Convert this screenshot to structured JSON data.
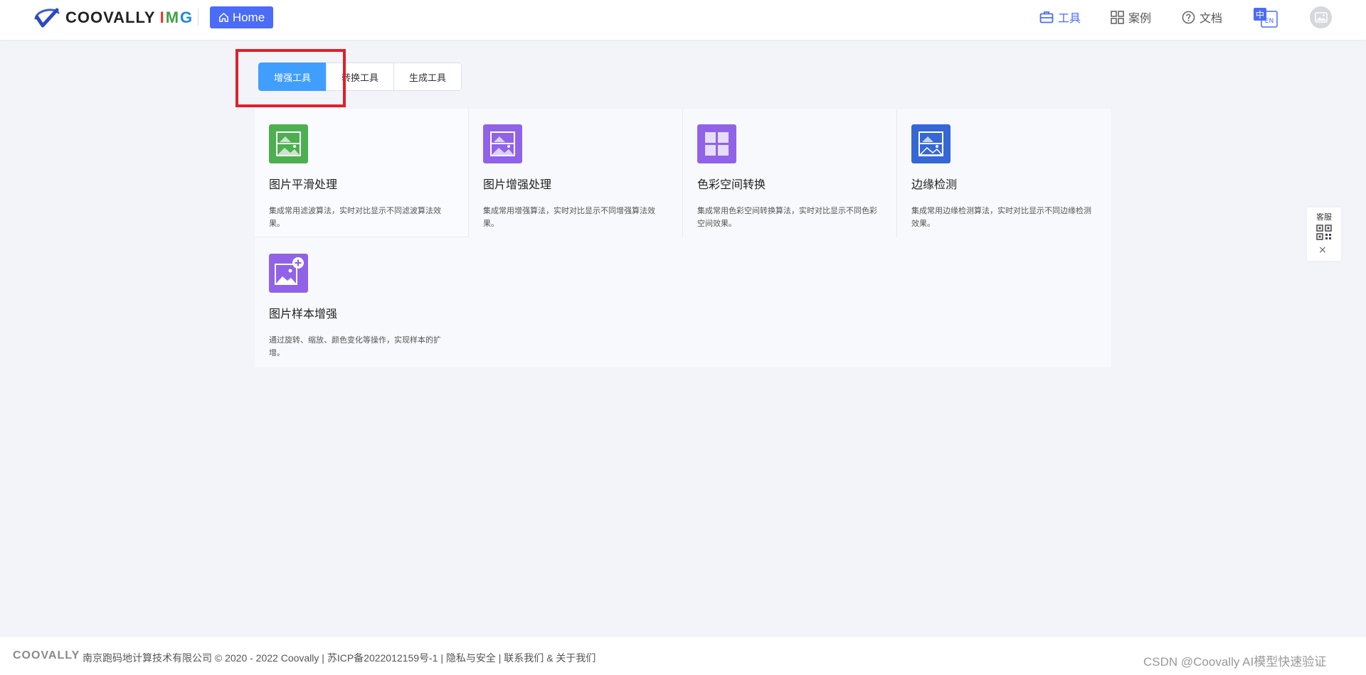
{
  "header": {
    "logo": {
      "word": "COOVALLY",
      "suffix": "IMG"
    },
    "home_button": {
      "label": "Home",
      "icon": "home-icon"
    },
    "nav": [
      {
        "label": "工具",
        "icon": "toolbox-icon",
        "active": true
      },
      {
        "label": "案例",
        "icon": "grid-icon",
        "active": false
      },
      {
        "label": "文档",
        "icon": "help-circle-icon",
        "active": false
      }
    ],
    "language": {
      "primary": "中",
      "secondary": "EN"
    },
    "colors": {
      "accent": "#4a6cf7"
    }
  },
  "tabs": [
    {
      "label": "增强工具",
      "active": true
    },
    {
      "label": "转换工具",
      "active": false
    },
    {
      "label": "生成工具",
      "active": false
    }
  ],
  "cards": [
    {
      "title": "图片平滑处理",
      "desc": "集成常用滤波算法，实时对比显示不同滤波算法效果。",
      "icon": "image-smooth-icon",
      "color": "#4caf50"
    },
    {
      "title": "图片增强处理",
      "desc": "集成常用增强算法，实时对比显示不同增强算法效果。",
      "icon": "image-enhance-icon",
      "color": "#9062e8"
    },
    {
      "title": "色彩空间转换",
      "desc": "集成常用色彩空间转换算法，实时对比显示不同色彩空间效果。",
      "icon": "color-space-icon",
      "color": "#9062e8"
    },
    {
      "title": "边缘检测",
      "desc": "集成常用边缘检测算法，实时对比显示不同边缘检测效果。",
      "icon": "edge-detect-icon",
      "color": "#3567d6"
    },
    {
      "title": "图片样本增强",
      "desc": "通过旋转、缩放、颜色变化等操作，实现样本的扩增。",
      "icon": "image-add-icon",
      "color": "#9062e8"
    }
  ],
  "service": {
    "label": "客服",
    "close": "×"
  },
  "footer": {
    "logo": "COOVALLY",
    "text": "南京跑码地计算技术有限公司 © 2020 - 2022 Coovally | 苏ICP备2022012159号-1 | 隐私与安全 | 联系我们 & 关于我们"
  },
  "watermark": "CSDN @Coovally   AI模型快速验证"
}
